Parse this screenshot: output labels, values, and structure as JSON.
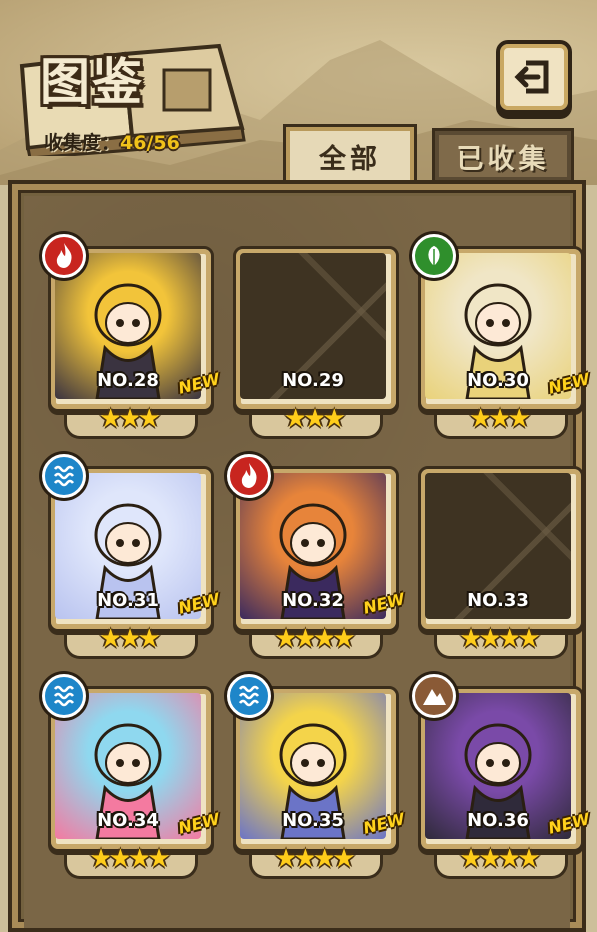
{
  "header": {
    "title": "图鉴",
    "progress_label": "收集度：",
    "progress_value": "46/56"
  },
  "tabs": [
    {
      "label": "全部",
      "active": true
    },
    {
      "label": "已收集",
      "active": false
    }
  ],
  "cards": [
    {
      "number": "NO.28",
      "stars": 3,
      "element": "fire",
      "new": true,
      "locked": false,
      "new_label": "NEW",
      "palette": [
        "#f2c43a",
        "#3a3340"
      ]
    },
    {
      "number": "NO.29",
      "stars": 3,
      "element": null,
      "new": false,
      "locked": true,
      "new_label": ""
    },
    {
      "number": "NO.30",
      "stars": 3,
      "element": "wood",
      "new": true,
      "locked": false,
      "new_label": "NEW",
      "palette": [
        "#f0e6c6",
        "#e9d27a"
      ]
    },
    {
      "number": "NO.31",
      "stars": 3,
      "element": "water",
      "new": true,
      "locked": false,
      "new_label": "NEW",
      "palette": [
        "#dfe6fb",
        "#b9c3ef"
      ]
    },
    {
      "number": "NO.32",
      "stars": 4,
      "element": "fire",
      "new": true,
      "locked": false,
      "new_label": "NEW",
      "palette": [
        "#e7843a",
        "#3b2a5e"
      ]
    },
    {
      "number": "NO.33",
      "stars": 4,
      "element": null,
      "new": false,
      "locked": true,
      "new_label": ""
    },
    {
      "number": "NO.34",
      "stars": 4,
      "element": "water",
      "new": true,
      "locked": false,
      "new_label": "NEW",
      "palette": [
        "#8fd8ef",
        "#f47aa0"
      ]
    },
    {
      "number": "NO.35",
      "stars": 4,
      "element": "water",
      "new": true,
      "locked": false,
      "new_label": "NEW",
      "palette": [
        "#f4d44a",
        "#6b74c7"
      ]
    },
    {
      "number": "NO.36",
      "stars": 4,
      "element": "earth",
      "new": true,
      "locked": false,
      "new_label": "NEW",
      "palette": [
        "#7a4aa8",
        "#2f2a3a"
      ]
    }
  ],
  "colors": {
    "star": "#ffcd1a",
    "new_badge": "#ffd21c",
    "progress_value": "#f0c21a"
  }
}
